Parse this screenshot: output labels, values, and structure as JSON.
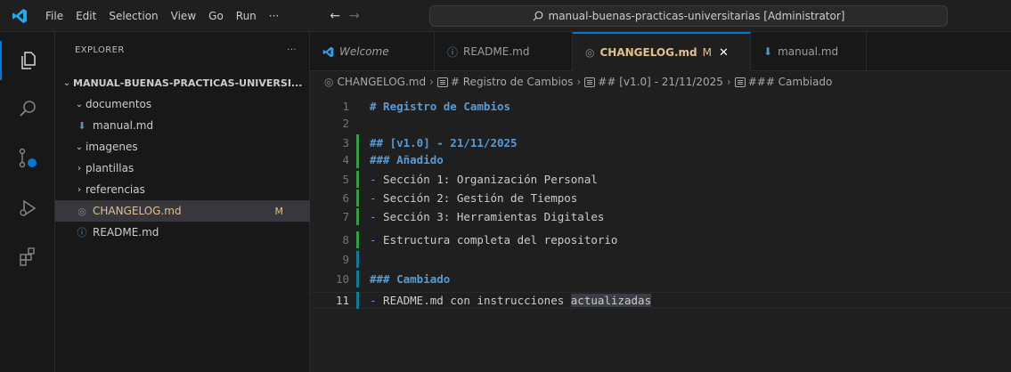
{
  "menu": [
    "File",
    "Edit",
    "Selection",
    "View",
    "Go",
    "Run",
    "···"
  ],
  "search": {
    "text": "manual-buenas-practicas-universitarias [Administrator]"
  },
  "explorer": {
    "title": "EXPLORER",
    "more": "···",
    "root": "MANUAL-BUENAS-PRACTICAS-UNIVERSI...",
    "items": [
      {
        "chev": "⌄",
        "icon": "",
        "label": "documentos"
      },
      {
        "chev": "",
        "icon": "⬇",
        "label": "manual.md"
      },
      {
        "chev": "⌄",
        "icon": "",
        "label": "imagenes"
      },
      {
        "chev": "›",
        "icon": "",
        "label": "plantillas"
      },
      {
        "chev": "›",
        "icon": "",
        "label": "referencias"
      },
      {
        "chev": "",
        "icon": "◎",
        "label": "CHANGELOG.md",
        "badge": "M"
      },
      {
        "chev": "",
        "icon": "ⓘ",
        "label": "README.md"
      }
    ]
  },
  "tabs": [
    {
      "label": "Welcome",
      "icon": "vscode"
    },
    {
      "label": "README.md",
      "icon": "ⓘ"
    },
    {
      "label": "CHANGELOG.md",
      "icon": "◎",
      "mod": "M",
      "close": "✕"
    },
    {
      "label": "manual.md",
      "icon": "⬇"
    }
  ],
  "breadcrumb": [
    "CHANGELOG.md",
    "# Registro de Cambios",
    "## [v1.0] - 21/11/2025",
    "### Cambiado"
  ],
  "editor": {
    "lines": [
      {
        "n": "1",
        "text": "# Registro de Cambios"
      },
      {
        "n": "2",
        "text": ""
      },
      {
        "n": "3",
        "text": "## [v1.0] - 21/11/2025"
      },
      {
        "n": "4",
        "text": "### Añadido"
      },
      {
        "n": "5",
        "bullet": "-",
        "text": " Sección 1: Organización Personal"
      },
      {
        "n": "6",
        "bullet": "-",
        "text": " Sección 2: Gestión de Tiempos"
      },
      {
        "n": "7",
        "bullet": "-",
        "text": " Sección 3: Herramientas Digitales"
      },
      {
        "n": "8",
        "bullet": "-",
        "text": " Estructura completa del repositorio"
      },
      {
        "n": "9",
        "text": ""
      },
      {
        "n": "10",
        "text": "### Cambiado"
      },
      {
        "n": "11",
        "bullet": "-",
        "text": " README.md con instrucciones ",
        "highlight": "actualizadas"
      }
    ]
  },
  "colors": {
    "accent": "#0078d4",
    "modified": "#e2c08d",
    "heading": "#569cd6"
  }
}
